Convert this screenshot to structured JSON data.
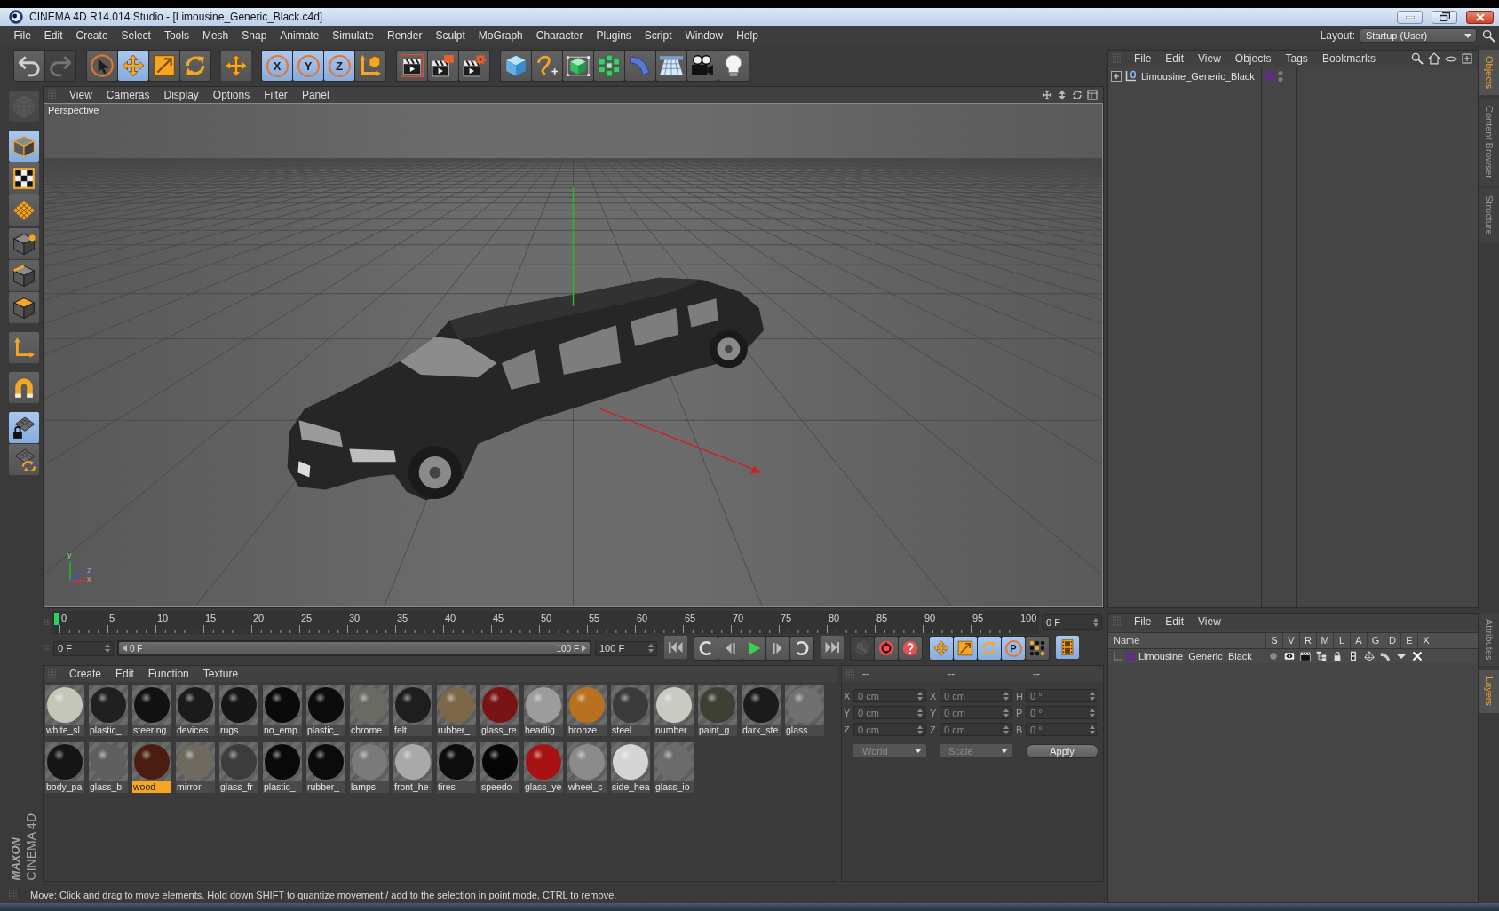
{
  "window": {
    "title": "CINEMA 4D R14.014 Studio - [Limousine_Generic_Black.c4d]"
  },
  "menu_bar": [
    "File",
    "Edit",
    "Create",
    "Select",
    "Tools",
    "Mesh",
    "Snap",
    "Animate",
    "Simulate",
    "Render",
    "Sculpt",
    "MoGraph",
    "Character",
    "Plugins",
    "Script",
    "Window",
    "Help"
  ],
  "layout": {
    "label": "Layout:",
    "value": "Startup (User)"
  },
  "toolbar": [
    [
      {
        "kind": "undo",
        "selected": false,
        "disabled": false
      },
      {
        "kind": "redo",
        "selected": false,
        "disabled": true
      }
    ],
    [
      {
        "kind": "select",
        "selected": false,
        "disabled": false
      },
      {
        "kind": "move",
        "selected": true,
        "disabled": false
      },
      {
        "kind": "scale",
        "selected": false,
        "disabled": false
      },
      {
        "kind": "rotate",
        "selected": false,
        "disabled": false
      }
    ],
    [
      {
        "kind": "recent",
        "selected": false,
        "disabled": false
      }
    ],
    [
      {
        "kind": "axis",
        "label": "X",
        "selected": true,
        "disabled": false
      },
      {
        "kind": "axis",
        "label": "Y",
        "selected": true,
        "disabled": false
      },
      {
        "kind": "axis",
        "label": "Z",
        "selected": true,
        "disabled": false
      },
      {
        "kind": "coord",
        "selected": false,
        "disabled": false
      }
    ],
    [
      {
        "kind": "render-view",
        "selected": false,
        "disabled": false
      },
      {
        "kind": "render-pv",
        "selected": false,
        "disabled": false
      },
      {
        "kind": "render-settings",
        "selected": false,
        "disabled": false
      }
    ],
    [
      {
        "kind": "cube",
        "selected": false,
        "disabled": false
      },
      {
        "kind": "spline",
        "selected": false,
        "disabled": false
      },
      {
        "kind": "subdiv",
        "selected": false,
        "disabled": false
      },
      {
        "kind": "cloner",
        "selected": false,
        "disabled": false
      },
      {
        "kind": "bend",
        "selected": false,
        "disabled": false
      },
      {
        "kind": "floor",
        "selected": false,
        "disabled": false
      },
      {
        "kind": "camera",
        "selected": false,
        "disabled": false
      },
      {
        "kind": "light",
        "selected": false,
        "disabled": false
      }
    ]
  ],
  "tool_palette": [
    [
      {
        "kind": "editable",
        "selected": false,
        "disabled": true
      }
    ],
    [
      {
        "kind": "model",
        "selected": true,
        "disabled": false
      },
      {
        "kind": "texture",
        "selected": false,
        "disabled": false
      },
      {
        "kind": "workplane",
        "selected": false,
        "disabled": false
      }
    ],
    [
      {
        "kind": "points",
        "selected": false,
        "disabled": false
      },
      {
        "kind": "edges",
        "selected": false,
        "disabled": false
      },
      {
        "kind": "polygons",
        "selected": false,
        "disabled": false
      }
    ],
    [
      {
        "kind": "axis-mode",
        "selected": false,
        "disabled": false
      }
    ],
    [
      {
        "kind": "snap",
        "selected": false,
        "disabled": false
      }
    ],
    [
      {
        "kind": "lock-plane",
        "selected": true,
        "disabled": false
      },
      {
        "kind": "align-plane",
        "selected": false,
        "disabled": false
      }
    ]
  ],
  "viewport": {
    "menu": [
      "View",
      "Cameras",
      "Display",
      "Options",
      "Filter",
      "Panel"
    ],
    "camera": "Perspective",
    "axis_labels": [
      "y",
      "z",
      "x"
    ]
  },
  "timeline": {
    "ticks": [
      "0",
      "5",
      "10",
      "15",
      "20",
      "25",
      "30",
      "35",
      "40",
      "45",
      "50",
      "55",
      "60",
      "65",
      "70",
      "75",
      "80",
      "85",
      "90",
      "95",
      "100"
    ],
    "level": 0,
    "frame": "0 F"
  },
  "playback": {
    "start": "0 F",
    "range": {
      "start": "0 F",
      "end": "100 F",
      "level": 1
    },
    "end": "100 F",
    "groups": [
      [
        {
          "kind": "first",
          "selected": false,
          "disabled": false
        }
      ],
      [
        {
          "kind": "prev-key",
          "selected": false,
          "disabled": false
        },
        {
          "kind": "step-back",
          "selected": false,
          "disabled": false
        },
        {
          "kind": "play",
          "selected": false,
          "disabled": false
        },
        {
          "kind": "step-forward",
          "selected": false,
          "disabled": false
        },
        {
          "kind": "next-key",
          "selected": false,
          "disabled": false
        }
      ],
      [
        {
          "kind": "last",
          "selected": false,
          "disabled": false
        }
      ],
      [
        {
          "kind": "key",
          "selected": false,
          "disabled": true
        },
        {
          "kind": "record",
          "selected": false,
          "disabled": false
        },
        {
          "kind": "auto-key",
          "selected": false,
          "disabled": false
        }
      ],
      [
        {
          "kind": "key-move",
          "selected": true,
          "disabled": false
        },
        {
          "kind": "key-scale",
          "selected": true,
          "disabled": false
        },
        {
          "kind": "key-rotate",
          "selected": true,
          "disabled": false
        },
        {
          "kind": "key-param",
          "label": "P",
          "selected": true,
          "disabled": false
        },
        {
          "kind": "key-dots",
          "selected": false,
          "disabled": false
        }
      ],
      [
        {
          "kind": "film",
          "selected": true,
          "disabled": false
        }
      ]
    ]
  },
  "materials": {
    "menu": [
      "Create",
      "Edit",
      "Function",
      "Texture"
    ],
    "items": [
      {
        "name": "white_sl",
        "color": "#c6c6b8",
        "selected": false
      },
      {
        "name": "plastic_",
        "color": "#202020",
        "selected": false
      },
      {
        "name": "steering",
        "color": "#121212",
        "selected": false
      },
      {
        "name": "devices",
        "color": "#1b1b1b",
        "selected": false
      },
      {
        "name": "rugs",
        "color": "#161616",
        "selected": false
      },
      {
        "name": "no_emp",
        "color": "#0a0a0a",
        "selected": false
      },
      {
        "name": "plastic_",
        "color": "#0c0c0c",
        "selected": false
      },
      {
        "name": "chrome",
        "color": "#6b6a62",
        "selected": false
      },
      {
        "name": "felt",
        "color": "#1e1e1e",
        "selected": false
      },
      {
        "name": "rubber_",
        "color": "#7d6749",
        "selected": false
      },
      {
        "name": "glass_re",
        "color": "#7a1414",
        "selected": false
      },
      {
        "name": "headlig",
        "color": "#9c9c9c",
        "selected": false
      },
      {
        "name": "bronze",
        "color": "#b9711f",
        "selected": false
      },
      {
        "name": "steel",
        "color": "#3b3b3b",
        "selected": false
      },
      {
        "name": "number",
        "color": "#cacac2",
        "selected": false
      },
      {
        "name": "paint_g",
        "color": "#3f4034",
        "selected": false
      },
      {
        "name": "dark_ste",
        "color": "#1b1b1b",
        "selected": false
      },
      {
        "name": "glass",
        "color": "#707070",
        "selected": false
      },
      {
        "name": "body_pa",
        "color": "#151515",
        "selected": false
      },
      {
        "name": "glass_bl",
        "color": "#5f5f5f",
        "selected": false
      },
      {
        "name": "wood",
        "color": "#4b1d10",
        "selected": true
      },
      {
        "name": "mirror",
        "color": "#6f6a5e",
        "selected": false
      },
      {
        "name": "glass_fr",
        "color": "#3c3c3c",
        "selected": false
      },
      {
        "name": "plastic_",
        "color": "#090909",
        "selected": false
      },
      {
        "name": "rubber_",
        "color": "#0b0b0b",
        "selected": false
      },
      {
        "name": "lamps",
        "color": "#7a7a7a",
        "selected": false
      },
      {
        "name": "front_he",
        "color": "#a9a9a9",
        "selected": false
      },
      {
        "name": "tires",
        "color": "#0d0d0d",
        "selected": false
      },
      {
        "name": "speedo",
        "color": "#060606",
        "selected": false
      },
      {
        "name": "glass_ye",
        "color": "#a91212",
        "selected": false
      },
      {
        "name": "wheel_c",
        "color": "#8b8b8b",
        "selected": false
      },
      {
        "name": "side_hea",
        "color": "#d5d5d5",
        "selected": false
      },
      {
        "name": "glass_io",
        "color": "#6b6b6b",
        "selected": false
      }
    ]
  },
  "coordinates": {
    "disabled": true,
    "headers": [
      "--",
      "--",
      "--"
    ],
    "rows": [
      {
        "fields": [
          {
            "label": "X",
            "value": "0 cm"
          },
          {
            "label": "X",
            "value": "0 cm"
          },
          {
            "label": "H",
            "value": "0 °"
          }
        ]
      },
      {
        "fields": [
          {
            "label": "Y",
            "value": "0 cm"
          },
          {
            "label": "Y",
            "value": "0 cm"
          },
          {
            "label": "P",
            "value": "0 °"
          }
        ]
      },
      {
        "fields": [
          {
            "label": "Z",
            "value": "0 cm"
          },
          {
            "label": "Z",
            "value": "0 cm"
          },
          {
            "label": "B",
            "value": "0 °"
          }
        ]
      }
    ],
    "dropdowns": [
      "World",
      "Scale"
    ],
    "apply": "Apply"
  },
  "objects_panel": {
    "menu": [
      "File",
      "Edit",
      "View",
      "Objects",
      "Tags",
      "Bookmarks"
    ],
    "objects": [
      {
        "name": "Limousine_Generic_Black",
        "expanded": false,
        "color": "#5c2f80"
      }
    ]
  },
  "layers_panel": {
    "menu": [
      "File",
      "Edit",
      "View"
    ],
    "columns": [
      "Name",
      "S",
      "V",
      "R",
      "M",
      "L",
      "A",
      "G",
      "D",
      "E",
      "X"
    ],
    "layers": [
      {
        "name": "Limousine_Generic_Black",
        "color": "#5c2f80"
      }
    ]
  },
  "side_tabs": {
    "top": [
      {
        "label": "Objects",
        "selected": true
      },
      {
        "label": "Content Browser",
        "selected": false
      },
      {
        "label": "Structure",
        "selected": false
      }
    ],
    "bottom": [
      {
        "label": "Attributes",
        "selected": false
      },
      {
        "label": "Layers",
        "selected": true
      }
    ]
  },
  "logo": {
    "brand": "MAXON",
    "product": "CINEMA 4D"
  },
  "status_bar": "Move: Click and drag to move elements. Hold down SHIFT to quantize movement / add to the selection in point mode, CTRL to remove."
}
